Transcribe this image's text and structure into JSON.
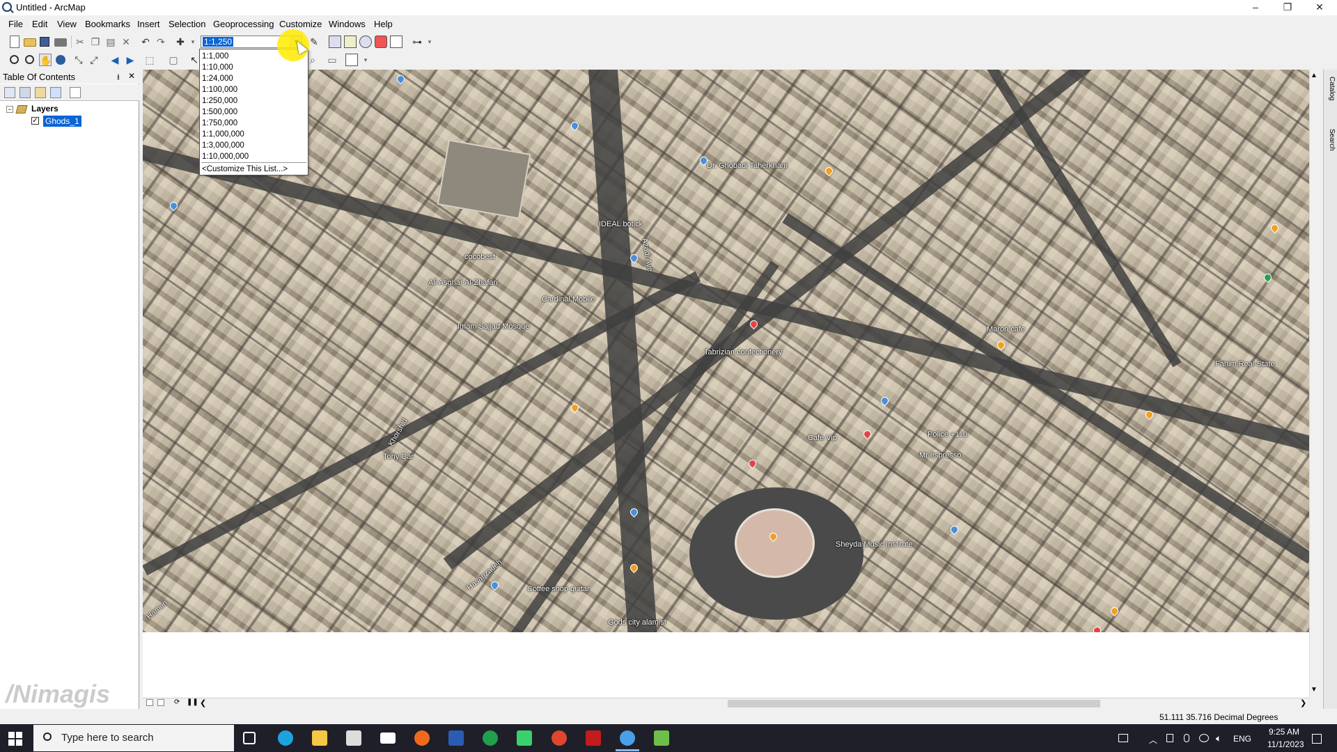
{
  "window": {
    "title": "Untitled - ArcMap",
    "minimize": "–",
    "restore": "❐",
    "close": "✕"
  },
  "menu": [
    "File",
    "Edit",
    "View",
    "Bookmarks",
    "Insert",
    "Selection",
    "Geoprocessing",
    "Customize",
    "Windows",
    "Help"
  ],
  "scale": {
    "current": "1:1,250",
    "options": [
      "1:1,000",
      "1:10,000",
      "1:24,000",
      "1:100,000",
      "1:250,000",
      "1:500,000",
      "1:750,000",
      "1:1,000,000",
      "1:3,000,000",
      "1:10,000,000"
    ],
    "customize": "<Customize This List...>"
  },
  "toc": {
    "title": "Table Of Contents",
    "pin": "⭳",
    "close": "✕",
    "layers_label": "Layers",
    "expander": "−",
    "checkmark": "✓",
    "layer_name": "Ghods_1"
  },
  "map_labels": [
    "Ali Asghar Al-Zhafari",
    "Dr. Ghobadi Taherkhani",
    "IDEAL botick",
    "Azadi Ave",
    "cocobest",
    "Cardinal Mobile",
    "Imam Sajjad Mosque",
    "Tabrizian confectionery",
    "Maron cafe",
    "Fahim Real-State",
    "Cafe Vip",
    "Police +110",
    "Mr espresso",
    "Tony Car",
    "Khorshid",
    "Hasanzadeh",
    "Coffee shop guitar",
    "Sheyda Music Institute",
    "Gods city alamist",
    "Hamun"
  ],
  "watermark": "/Nimagis",
  "right_dock": [
    "Catalog",
    "Search"
  ],
  "status": {
    "coordinates": "51.111  35.716 Decimal Degrees"
  },
  "scrollbar": {
    "up": "▲",
    "down": "▼",
    "left": "❮",
    "right": "❯"
  },
  "taskbar": {
    "search_placeholder": "Type here to search",
    "language": "ENG",
    "time": "9:25 AM",
    "date": "11/1/2023"
  },
  "colors": {
    "accent": "#0a64d6",
    "taskbar": "#1f1f2a",
    "cursor_highlight": "#ffeb00"
  }
}
